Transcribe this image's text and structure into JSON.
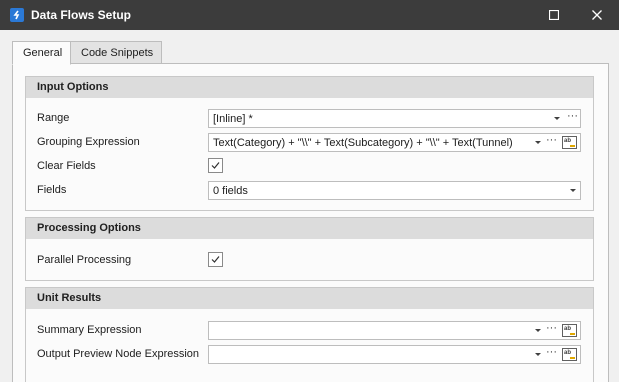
{
  "window": {
    "title": "Data Flows Setup"
  },
  "tabs": [
    {
      "label": "General",
      "active": true
    },
    {
      "label": "Code Snippets",
      "active": false
    }
  ],
  "input_options": {
    "header": "Input Options",
    "range": {
      "label": "Range",
      "value": "[Inline] *"
    },
    "grouping_expression": {
      "label": "Grouping Expression",
      "value": "Text(Category) + \"\\\\\" + Text(Subcategory) + \"\\\\\" + Text(Tunnel)"
    },
    "clear_fields": {
      "label": "Clear Fields",
      "checked": true
    },
    "fields": {
      "label": "Fields",
      "value": "0 fields"
    }
  },
  "processing_options": {
    "header": "Processing Options",
    "parallel_processing": {
      "label": "Parallel Processing",
      "checked": true
    }
  },
  "unit_results": {
    "header": "Unit Results",
    "summary_expression": {
      "label": "Summary Expression",
      "value": ""
    },
    "output_preview_node_expression": {
      "label": "Output Preview Node Expression",
      "value": ""
    }
  },
  "icons": {
    "app": "app-logo-icon",
    "maximize": "maximize-icon",
    "close": "close-icon",
    "dropdown": "chevron-down-icon",
    "ellipsis": "ellipsis-icon",
    "expression_editor": "expression-editor-icon",
    "check": "checkmark-icon"
  },
  "colors": {
    "titlebar": "#3c3c3c",
    "accent": "#2b79d6",
    "group_header": "#dcdcdc"
  },
  "glyphs": {
    "ellipsis": "···",
    "expr": "ab"
  }
}
